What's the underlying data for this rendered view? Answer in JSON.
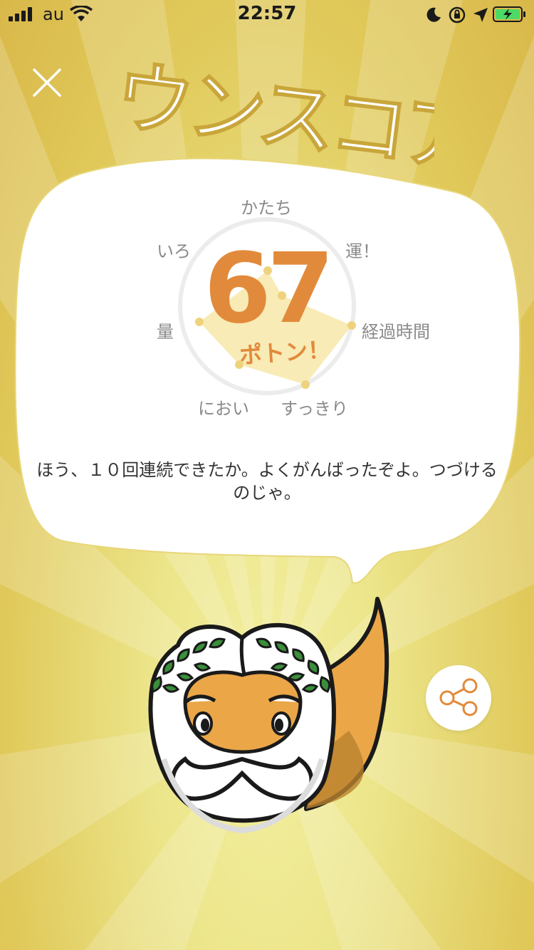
{
  "status": {
    "carrier": "au",
    "time": "22:57"
  },
  "title": "ウンスコア",
  "score": {
    "value": "67",
    "tag": "ポトン！"
  },
  "radar": {
    "axes": [
      "かたち",
      "運！",
      "経過時間",
      "すっきり",
      "におい",
      "量",
      "いろ"
    ]
  },
  "message": "ほう、１０回連続できたか。よくがんばったぞよ。つづけるのじゃ。",
  "colors": {
    "accent": "#e28a3b",
    "radar_fill": "#f7e7a8",
    "radar_point": "#efd27c",
    "leaf": "#3a8f3a"
  },
  "icons": {
    "close": "close-icon",
    "share": "share-icon"
  }
}
